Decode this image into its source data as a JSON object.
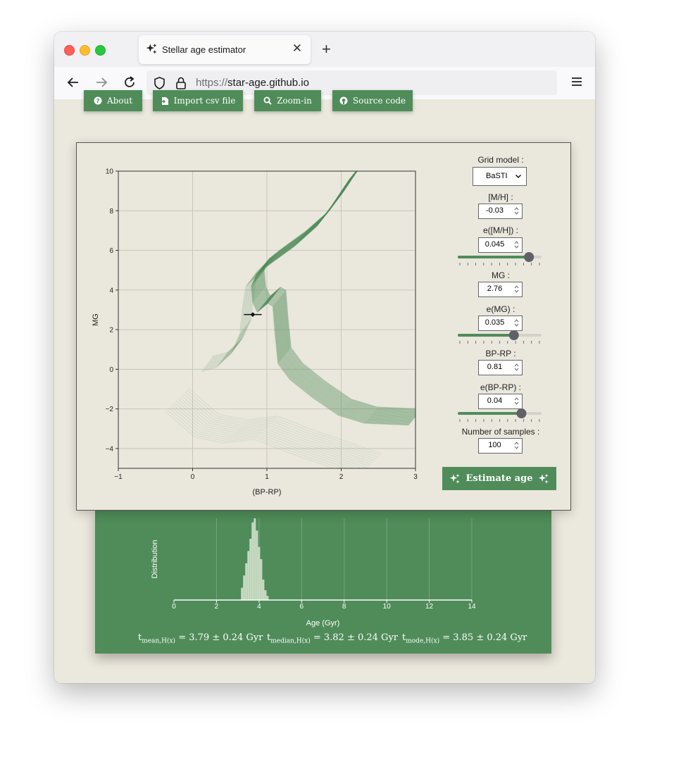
{
  "browser": {
    "tab_title": "Stellar age estimator",
    "url_protocol": "https://",
    "url_host": "star-age.github.io"
  },
  "toolbar": {
    "about": "About",
    "import": "Import csv file",
    "zoom": "Zoom-in",
    "source": "Source code"
  },
  "controls": {
    "grid_model_label": "Grid model :",
    "grid_model_value": "BaSTI",
    "mh_label": "[M/H] :",
    "mh_value": "-0.03",
    "emh_label": "e([M/H]) :",
    "emh_value": "0.045",
    "emh_slider_fraction": 0.85,
    "mg_label": "MG :",
    "mg_value": "2.76",
    "emg_label": "e(MG) :",
    "emg_value": "0.035",
    "emg_slider_fraction": 0.67,
    "bprp_label": "BP-RP :",
    "bprp_value": "0.81",
    "ebprp_label": "e(BP-RP) :",
    "ebprp_value": "0.04",
    "ebprp_slider_fraction": 0.76,
    "nsamples_label": "Number of samples :",
    "nsamples_value": "100",
    "estimate_label": "Estimate age"
  },
  "stats": {
    "mean_t": "t",
    "mean_sub": "mean,H(x)",
    "mean_value": " = 3.79 ± 0.24 Gyr",
    "median_t": "t",
    "median_sub": "median,H(x)",
    "median_value": " = 3.82 ± 0.24 Gyr",
    "mode_t": "t",
    "mode_sub": "mode,H(x)",
    "mode_value": " = 3.85 ± 0.24 Gyr"
  },
  "colors": {
    "accent": "#4f8c59",
    "panel_bg": "#eae7dd",
    "page_bg": "#ebe8dd"
  },
  "chart_data": [
    {
      "type": "line",
      "xlabel": "(BP-RP)",
      "ylabel": "MG",
      "xlim": [
        -1,
        3
      ],
      "ylim": [
        10,
        -5
      ],
      "y_inverted": true,
      "x_ticks": [
        "−1",
        "0",
        "1",
        "2",
        "3"
      ],
      "x_tick_values": [
        -1,
        0,
        1,
        2,
        3
      ],
      "y_ticks": [
        "−4",
        "−2",
        "0",
        "2",
        "4",
        "6",
        "8",
        "10"
      ],
      "y_tick_values": [
        -4,
        -2,
        0,
        2,
        4,
        6,
        8,
        10
      ],
      "grid": true,
      "star": {
        "x": 0.81,
        "y": 2.76,
        "xerr": 0.04,
        "yerr": 0.035
      },
      "isochrone_main_track": [
        [
          2.2,
          10
        ],
        [
          1.95,
          8.6
        ],
        [
          1.75,
          7.6
        ],
        [
          1.45,
          6.6
        ],
        [
          1.12,
          5.7
        ],
        [
          0.95,
          5.2
        ],
        [
          0.88,
          4.6
        ],
        [
          0.9,
          3.8
        ],
        [
          0.96,
          3.3
        ],
        [
          1.1,
          3.75
        ],
        [
          1.17,
          3.6
        ],
        [
          1.2,
          2.2
        ],
        [
          1.24,
          0.7
        ],
        [
          1.4,
          -0.1
        ],
        [
          1.7,
          -1.0
        ],
        [
          2.05,
          -1.9
        ],
        [
          2.4,
          -2.3
        ],
        [
          3.0,
          -2.4
        ]
      ],
      "isochrone_inner_track": [
        [
          1.05,
          5.5
        ],
        [
          0.8,
          4.6
        ],
        [
          0.75,
          3.4
        ],
        [
          0.72,
          2.2
        ],
        [
          0.6,
          1.2
        ],
        [
          0.4,
          0.5
        ],
        [
          0.2,
          0.3
        ]
      ],
      "isochrone_agb_track": [
        [
          -0.2,
          -1.5
        ],
        [
          0.2,
          -2.8
        ],
        [
          0.6,
          -3.1
        ],
        [
          1.0,
          -2.9
        ],
        [
          1.4,
          -3.5
        ],
        [
          2.4,
          -4.8
        ]
      ]
    },
    {
      "type": "bar",
      "xlabel": "Age (Gyr)",
      "ylabel": "Distribution",
      "xlim": [
        0,
        14
      ],
      "x_ticks": [
        "0",
        "2",
        "4",
        "6",
        "8",
        "10",
        "12",
        "14"
      ],
      "x_tick_values": [
        0,
        2,
        4,
        6,
        8,
        10,
        12,
        14
      ],
      "grid": true,
      "bins": [
        3.2,
        3.3,
        3.4,
        3.5,
        3.6,
        3.7,
        3.8,
        3.9,
        4.0,
        4.1,
        4.2,
        4.3,
        4.4
      ],
      "values": [
        0.15,
        0.3,
        0.45,
        0.6,
        0.75,
        0.95,
        1.0,
        0.85,
        0.65,
        0.5,
        0.25,
        0.12,
        0.05
      ]
    }
  ]
}
